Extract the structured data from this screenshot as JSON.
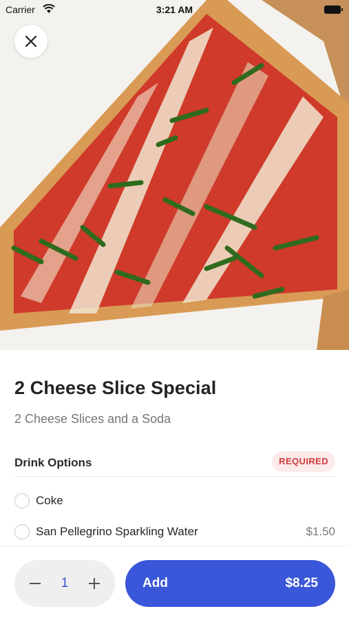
{
  "status_bar": {
    "carrier": "Carrier",
    "time": "3:21 AM"
  },
  "hero": {
    "image": "cheese-pizza-slice-photo",
    "close_icon": "close-icon"
  },
  "item": {
    "title": "2 Cheese Slice Special",
    "description": "2 Cheese Slices and a Soda"
  },
  "drink_options": {
    "title": "Drink Options",
    "badge": "REQUIRED",
    "options": [
      {
        "label": "Coke",
        "price": "",
        "selected": false
      },
      {
        "label": "San Pellegrino Sparkling Water",
        "price": "$1.50",
        "selected": false
      }
    ]
  },
  "footer": {
    "quantity": "1",
    "add_label": "Add",
    "total": "$8.25"
  },
  "colors": {
    "accent": "#3b57d9",
    "required_bg": "#fdeaea",
    "required_text": "#d13a3a"
  }
}
